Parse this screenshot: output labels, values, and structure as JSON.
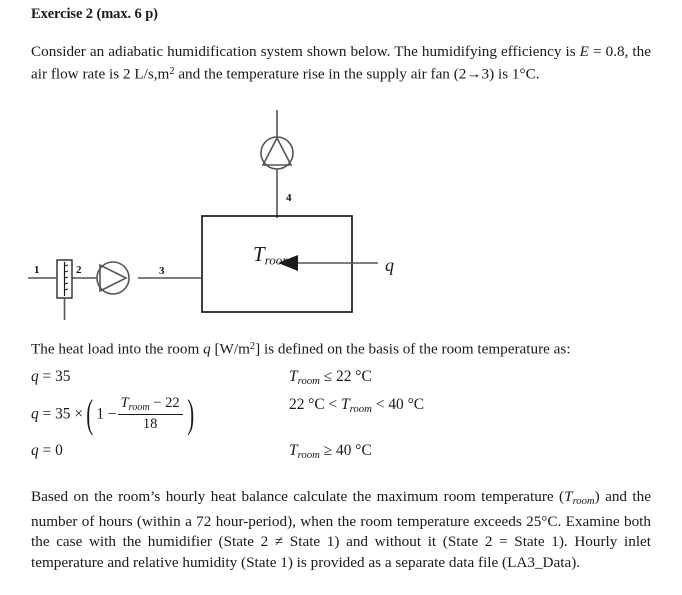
{
  "document": {
    "title": "Exercise 2 (max. 6 p)",
    "intro": {
      "prefix": "Consider an adiabatic humidification system shown below. The humidifying efficiency is ",
      "efficiency_symbol": "E",
      "efficiency_text": " = 0.8, the air flow rate is 2 L/s,m",
      "flow_exponent": "2",
      "mid_text": " and the temperature rise in the supply air fan (2",
      "arrow": "→",
      "fan_states_end": "3)",
      "tail": " is 1°C."
    },
    "heat_load_line": {
      "prefix": "The heat load into the room ",
      "q_symbol": "q",
      "bracket_open": " [W/m",
      "exponent": "2",
      "bracket_close": "]",
      "suffix": " is defined on the basis of the room temperature as:"
    },
    "task": {
      "line": "Based on the room’s hourly heat balance calculate the maximum room temperature (",
      "troom_symbol": "T",
      "troom_sub": "room",
      "after_troom": ") and the number of hours (within a 72 hour-period), when the room temperature exceeds 25°C. Examine both the case with the humidifier (State 2 ≠ State 1) and without it (State 2 = State 1). Hourly inlet temperature and relative humidity (State 1) is provided as a separate data file (LA3_Data)."
    }
  },
  "equations": {
    "rows": [
      {
        "id": "eq-1",
        "lhs_plain": "q = 35",
        "lhs_symbol": "q",
        "lhs_value": " = 35",
        "rhs_symbol": "T",
        "rhs_sub": "room",
        "rhs_rest": " ≤ 22 °C"
      },
      {
        "id": "eq-2",
        "lhs_symbol": "q",
        "lhs_value": " = 35 ×",
        "one_minus": "1 −",
        "numerator_symbol": "T",
        "numerator_sub": "room",
        "numerator_rest": " − 22",
        "denominator": "18",
        "rhs_left": "22 °C < ",
        "rhs_symbol": "T",
        "rhs_sub": "room",
        "rhs_rest": " < 40 °C"
      },
      {
        "id": "eq-3",
        "lhs_symbol": "q",
        "lhs_value": " = 0",
        "rhs_symbol": "T",
        "rhs_sub": "room",
        "rhs_rest": " ≥ 40 °C"
      }
    ]
  },
  "diagram": {
    "labels": {
      "state_1": "1",
      "state_2": "2",
      "state_3": "3",
      "state_4": "4",
      "room_symbol": "T",
      "room_sub": "room",
      "heat_load_symbol": "q"
    },
    "components": {
      "humidifier": "humidifier",
      "supply_fan": "supply-fan",
      "exhaust_fan": "exhaust-fan",
      "room": "room-box",
      "heat_arrow": "heat-load-arrow"
    }
  },
  "colors": {
    "ink": "#1a1a1a",
    "line": "#555555",
    "background": "#ffffff"
  }
}
